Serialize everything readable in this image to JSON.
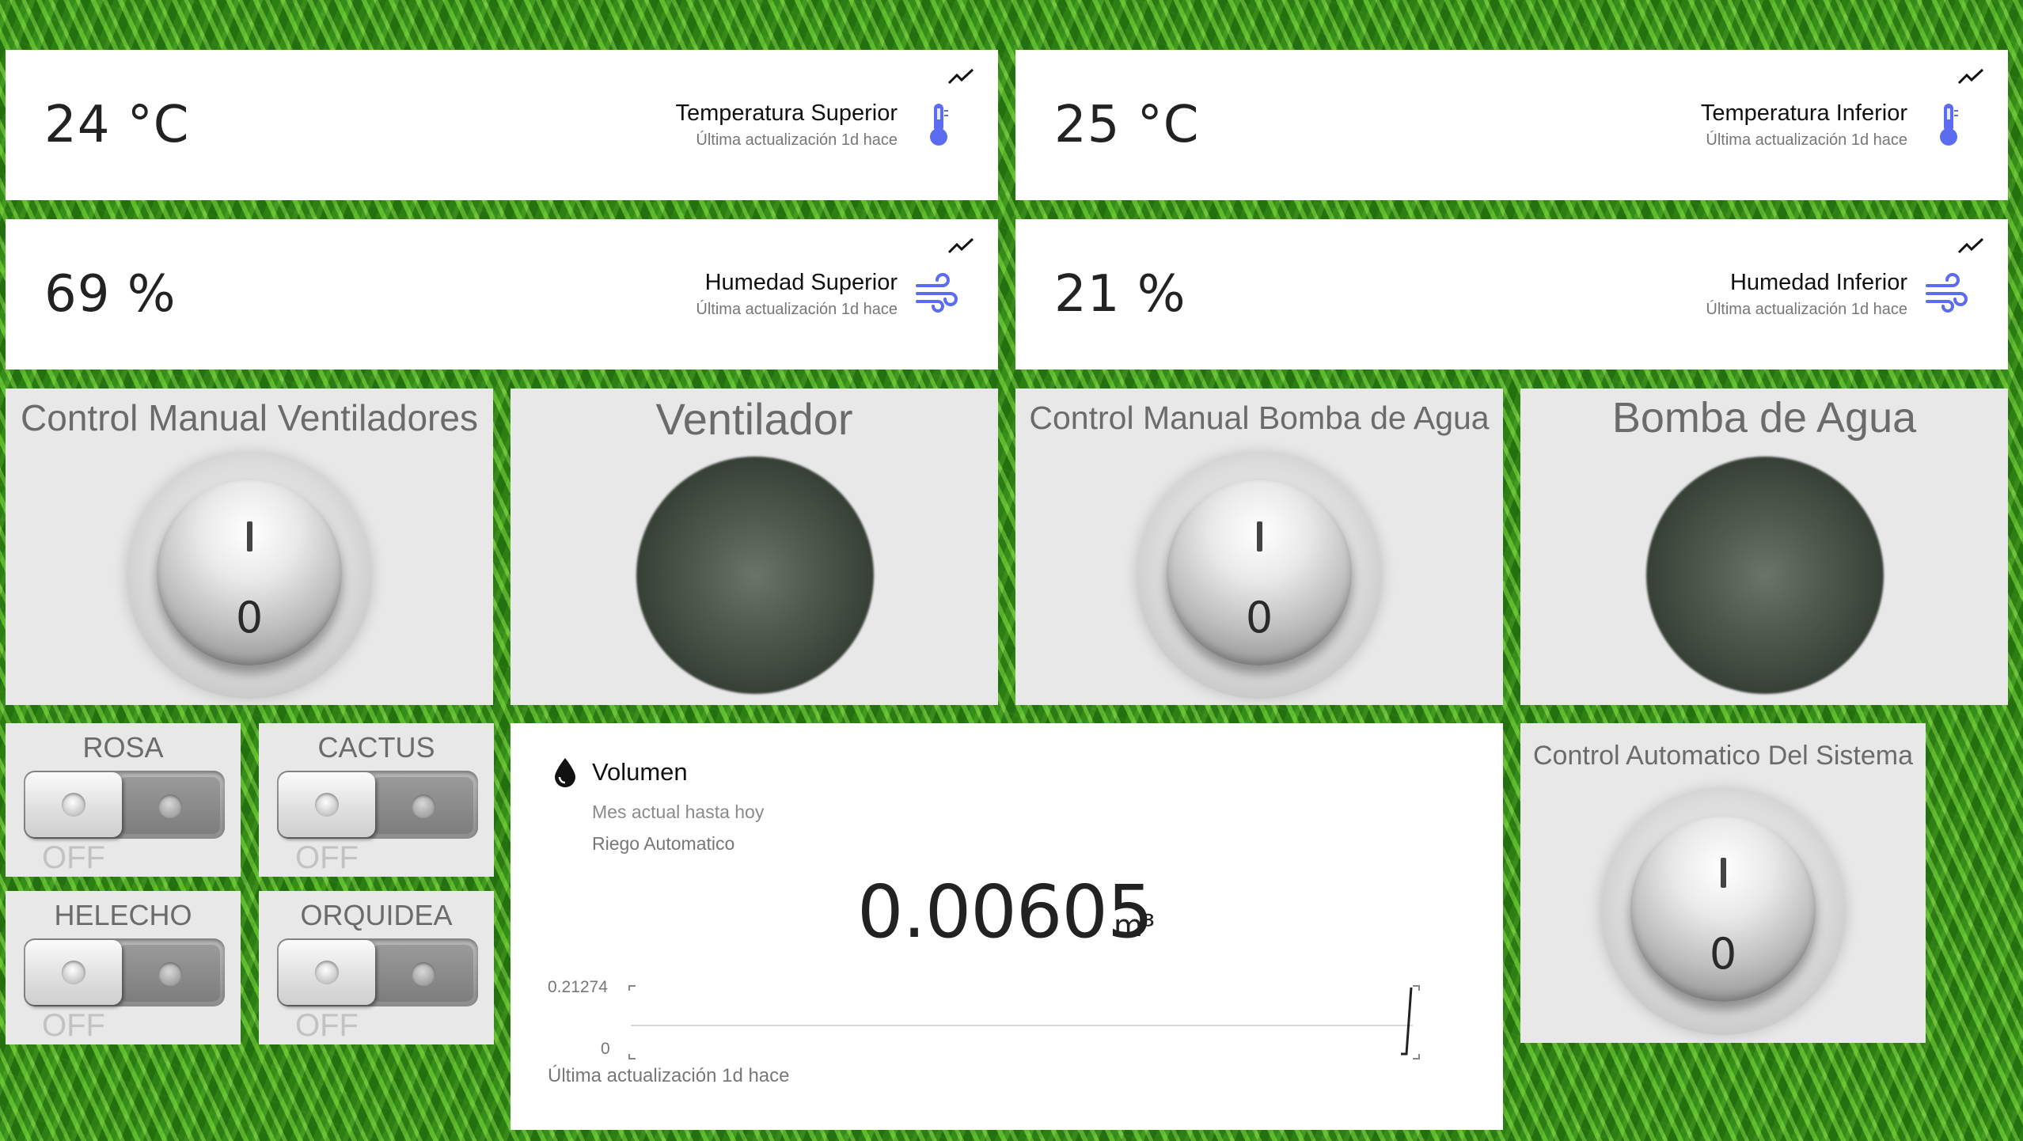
{
  "sensors": [
    {
      "value": "24 °C",
      "title": "Temperatura Superior",
      "updated": "Última actualización 1d hace",
      "icon": "thermometer-icon"
    },
    {
      "value": "25 °C",
      "title": "Temperatura Inferior",
      "updated": "Última actualización 1d hace",
      "icon": "thermometer-icon"
    },
    {
      "value": "69 %",
      "title": "Humedad Superior",
      "updated": "Última actualización 1d hace",
      "icon": "wind-icon"
    },
    {
      "value": "21 %",
      "title": "Humedad Inferior",
      "updated": "Última actualización 1d hace",
      "icon": "wind-icon"
    }
  ],
  "controls": {
    "fan_manual": {
      "title": "Control Manual Ventiladores",
      "mark_on": "I",
      "mark_off": "0"
    },
    "fan_indicator": {
      "title": "Ventilador"
    },
    "pump_manual": {
      "title": "Control Manual Bomba de Agua",
      "mark_on": "I",
      "mark_off": "0"
    },
    "pump_indicator": {
      "title": "Bomba de Agua"
    },
    "auto_system": {
      "title": "Control Automatico Del Sistema",
      "mark_on": "I",
      "mark_off": "0"
    }
  },
  "plants": [
    {
      "name": "ROSA",
      "state": "OFF"
    },
    {
      "name": "CACTUS",
      "state": "OFF"
    },
    {
      "name": "HELECHO",
      "state": "OFF"
    },
    {
      "name": "ORQUIDEA",
      "state": "OFF"
    }
  ],
  "volumen": {
    "title": "Volumen",
    "period": "Mes actual hasta hoy",
    "source": "Riego Automatico",
    "value": "0.00605",
    "unit": "m³",
    "axis_max": "0.21274",
    "axis_min": "0",
    "updated": "Última actualización 1d hace"
  },
  "colors": {
    "accent": "#5b6cf0",
    "panel": "#e8e8e9",
    "text_muted": "#6b6b6b"
  }
}
